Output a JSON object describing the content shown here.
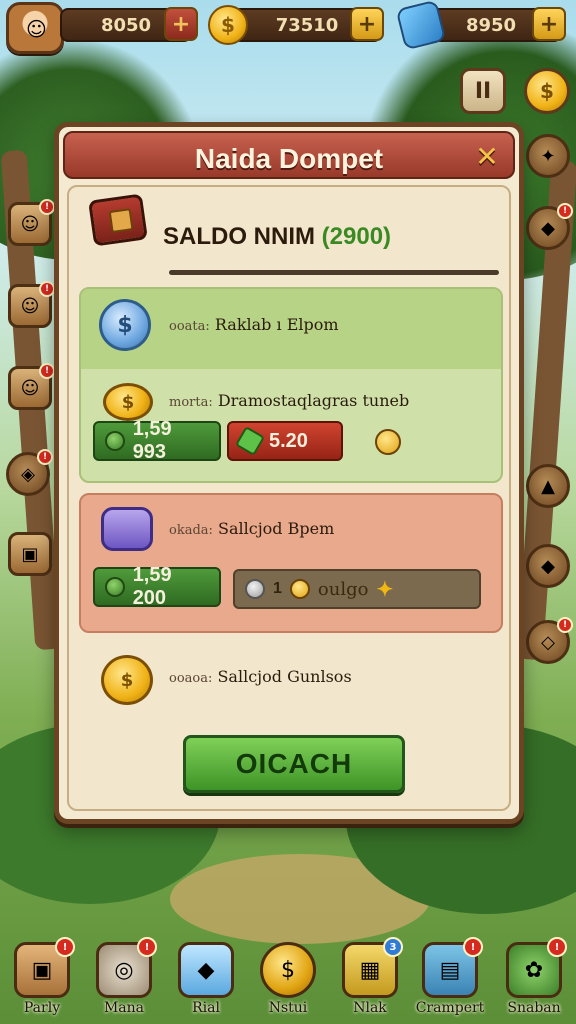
{
  "top_bar": {
    "resource_1": "8050",
    "resource_2": "73510",
    "resource_3": "8950",
    "plus_symbol": "+",
    "pause_symbol": "II",
    "coin_symbol": "$"
  },
  "dialog": {
    "title": "Naida Dompet",
    "close_symbol": "✕",
    "balance_label": "SALDO NNIM",
    "balance_value": "(2900)",
    "section_green": {
      "row_1": {
        "prefix": "ooata:",
        "label": "Raklab ı Elpom",
        "icon_symbol": "$"
      },
      "row_2": {
        "prefix": "morta:",
        "label": "Dramostaqlagras tuneb",
        "icon_symbol": "$"
      },
      "value_left": "1,59 993",
      "value_right": "5.20"
    },
    "section_pink": {
      "row_1": {
        "prefix": "okada:",
        "label": "Sallcjod Bpem"
      },
      "value_left": "1,59 200",
      "value_right_count": "1",
      "value_right_text": "oulgo"
    },
    "row_bottom": {
      "prefix": "ooaoa:",
      "label": "Sallcjod Gunlsos",
      "icon_symbol": "$"
    },
    "cta_label": "OICACH"
  },
  "bottom_nav": [
    {
      "label": "Parly",
      "badge": "!"
    },
    {
      "label": "Mana",
      "badge": "!"
    },
    {
      "label": "Rial",
      "badge": ""
    },
    {
      "label": "Nstui",
      "badge": ""
    },
    {
      "label": "Nlak",
      "badge": "3"
    },
    {
      "label": "Crampert",
      "badge": "!"
    },
    {
      "label": "Snaban",
      "badge": "!"
    }
  ],
  "side_badges": {
    "left_1": "!",
    "left_2": "!",
    "left_3": "!",
    "left_4": "!",
    "right_1": "!",
    "right_2": "!"
  },
  "colors": {
    "dialog_title_bar": "#c7614f",
    "cta_green": "#4fa02f",
    "section_green": "#cfe1a9",
    "section_pink": "#e9a98c"
  }
}
